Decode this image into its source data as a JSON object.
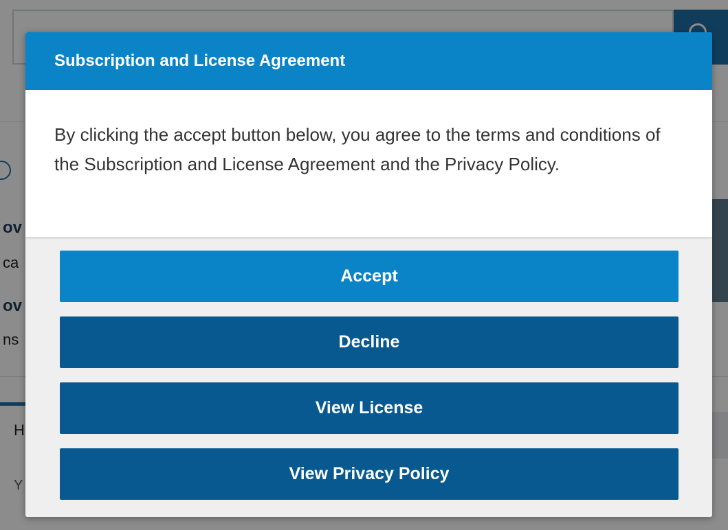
{
  "dialog": {
    "title": "Subscription and License Agreement",
    "message": "By clicking the accept button below, you agree to the terms and conditions of the Subscription and License Agreement and the Privacy Policy.",
    "buttons": {
      "accept": "Accept",
      "decline": "Decline",
      "view_license": "View License",
      "view_privacy": "View Privacy Policy"
    }
  },
  "background": {
    "partial_text": [
      "ov",
      "ca",
      "ov",
      "ns",
      "H",
      "Y"
    ]
  },
  "colors": {
    "header": "#0a84c6",
    "primary_button": "#0a84c6",
    "secondary_button": "#08598f"
  }
}
